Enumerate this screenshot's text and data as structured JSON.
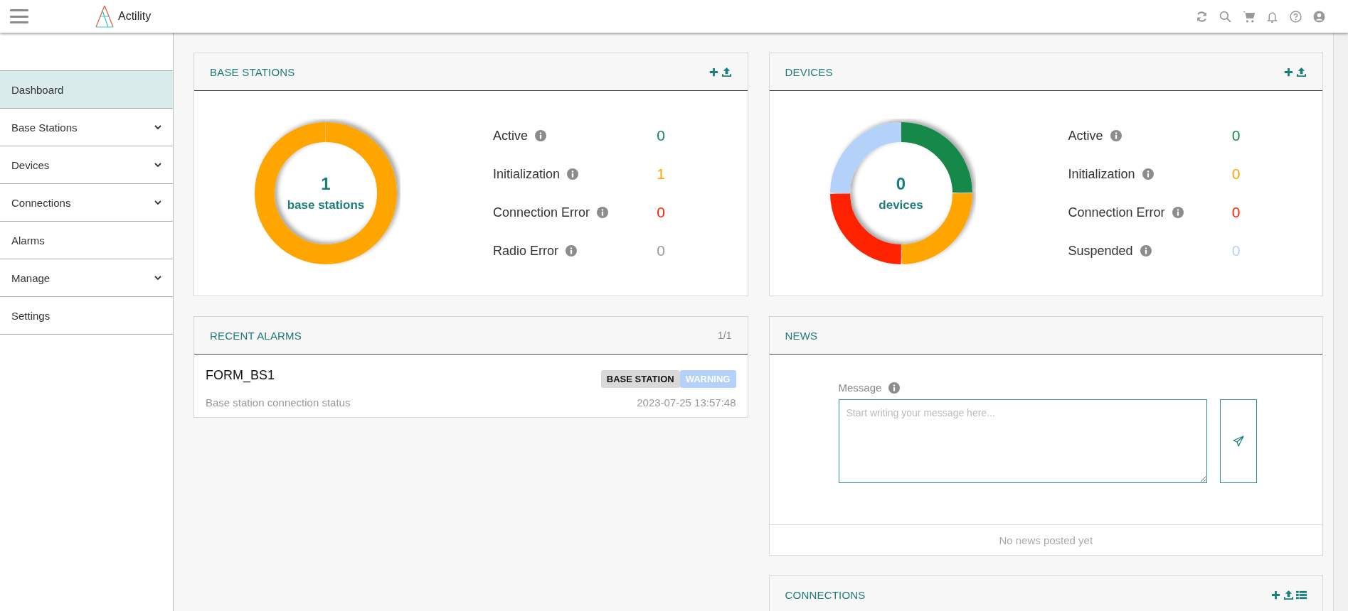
{
  "topbar": {
    "brand": "Actility"
  },
  "sidebar": {
    "items": [
      {
        "label": "Dashboard",
        "selected": true,
        "has_submenu": false
      },
      {
        "label": "Base Stations",
        "selected": false,
        "has_submenu": true
      },
      {
        "label": "Devices",
        "selected": false,
        "has_submenu": true
      },
      {
        "label": "Connections",
        "selected": false,
        "has_submenu": true
      },
      {
        "label": "Alarms",
        "selected": false,
        "has_submenu": false
      },
      {
        "label": "Manage",
        "selected": false,
        "has_submenu": true
      },
      {
        "label": "Settings",
        "selected": false,
        "has_submenu": false
      }
    ]
  },
  "base_stations": {
    "title": "BASE STATIONS",
    "total": "1",
    "total_label": "base stations",
    "stats": [
      {
        "label": "Active",
        "value": "0",
        "color": "#13884a"
      },
      {
        "label": "Initialization",
        "value": "1",
        "color": "#ffa500"
      },
      {
        "label": "Connection Error",
        "value": "0",
        "color": "#ff2200"
      },
      {
        "label": "Radio Error",
        "value": "0",
        "color": "#999999"
      }
    ]
  },
  "devices": {
    "title": "DEVICES",
    "total": "0",
    "total_label": "devices",
    "stats": [
      {
        "label": "Active",
        "value": "0",
        "color": "#13884a"
      },
      {
        "label": "Initialization",
        "value": "0",
        "color": "#ffa500"
      },
      {
        "label": "Connection Error",
        "value": "0",
        "color": "#ff2200"
      },
      {
        "label": "Suspended",
        "value": "0",
        "color": "#b3d1f9"
      }
    ]
  },
  "recent_alarms": {
    "title": "RECENT ALARMS",
    "pager": "1/1",
    "alarms": [
      {
        "name": "FORM_BS1",
        "description": "Base station connection status",
        "time": "2023-07-25 13:57:48",
        "tags": [
          {
            "label": "BASE STATION",
            "kind": "category"
          },
          {
            "label": "WARNING",
            "kind": "severity"
          }
        ]
      }
    ]
  },
  "news": {
    "title": "NEWS",
    "message_label": "Message",
    "placeholder": "Start writing your message here...",
    "empty_text": "No news posted yet"
  },
  "connections": {
    "title": "CONNECTIONS"
  }
}
